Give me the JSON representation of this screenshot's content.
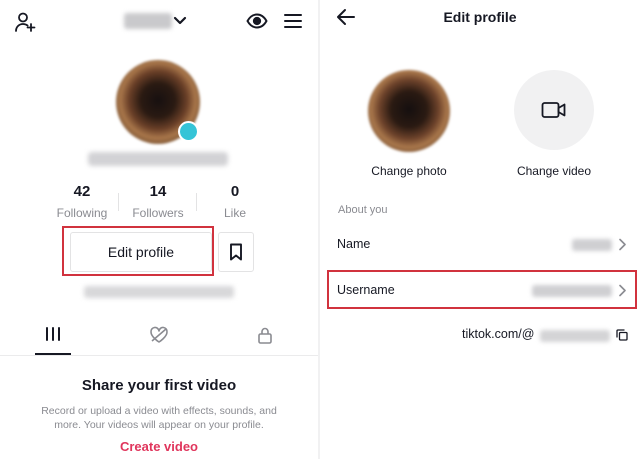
{
  "left": {
    "stats": [
      {
        "value": "42",
        "label": "Following"
      },
      {
        "value": "14",
        "label": "Followers"
      },
      {
        "value": "0",
        "label": "Like"
      }
    ],
    "edit_profile_label": "Edit profile",
    "empty_title": "Share your first video",
    "empty_desc": "Record or upload a video with effects, sounds, and more. Your videos will appear on your profile.",
    "create_label": "Create video"
  },
  "right": {
    "title": "Edit profile",
    "change_photo": "Change photo",
    "change_video": "Change video",
    "section_label": "About you",
    "rows": [
      {
        "label": "Name"
      },
      {
        "label": "Username"
      }
    ],
    "link_prefix": "tiktok.com/@"
  },
  "colors": {
    "highlight": "#d1323e",
    "accent": "#e0355c",
    "badge": "#35c4d7"
  }
}
